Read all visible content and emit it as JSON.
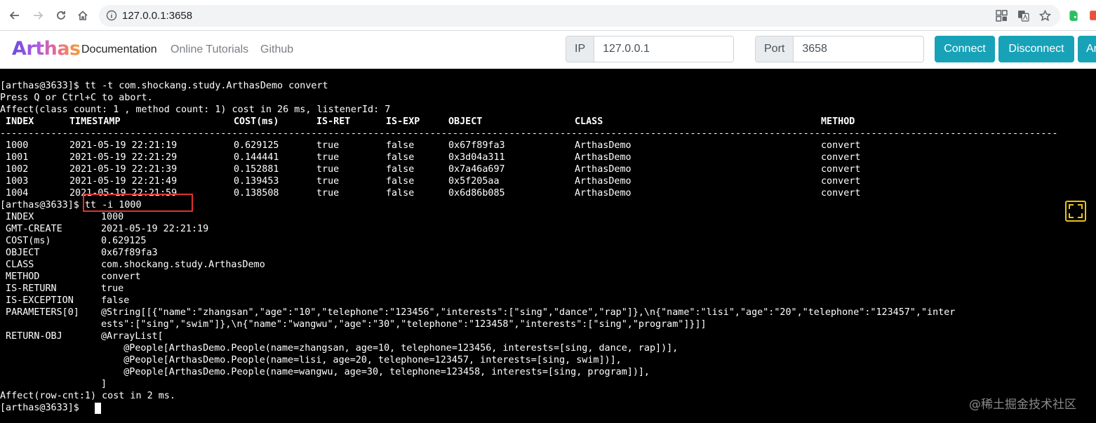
{
  "browser": {
    "url": "127.0.0.1:3658"
  },
  "app": {
    "logo": "Arthas",
    "nav": {
      "documentation": "Documentation",
      "tutorials": "Online Tutorials",
      "github": "Github"
    },
    "ip": {
      "label": "IP",
      "value": "127.0.0.1"
    },
    "port": {
      "label": "Port",
      "value": "3658"
    },
    "buttons": {
      "connect": "Connect",
      "disconnect": "Disconnect",
      "more": "Ar"
    },
    "colors": {
      "button": "#17a2b8"
    }
  },
  "terminal": {
    "cmd1": "[arthas@3633]$ tt -t com.shockang.study.ArthasDemo convert",
    "abort": "Press Q or Ctrl+C to abort.",
    "affect1": "Affect(class count: 1 , method count: 1) cost in 26 ms, listenerId: 7",
    "headers": {
      "index": " INDEX",
      "timestamp": "TIMESTAMP",
      "cost": "COST(ms)",
      "isret": "IS-RET",
      "isexp": "IS-EXP",
      "object": "OBJECT",
      "class": "CLASS",
      "method": "METHOD"
    },
    "rows": [
      {
        "index": " 1000",
        "timestamp": "2021-05-19 22:21:19",
        "cost": "0.629125",
        "isret": "true",
        "isexp": "false",
        "object": "0x67f89fa3",
        "class": "ArthasDemo",
        "method": "convert"
      },
      {
        "index": " 1001",
        "timestamp": "2021-05-19 22:21:29",
        "cost": "0.144441",
        "isret": "true",
        "isexp": "false",
        "object": "0x3d04a311",
        "class": "ArthasDemo",
        "method": "convert"
      },
      {
        "index": " 1002",
        "timestamp": "2021-05-19 22:21:39",
        "cost": "0.152881",
        "isret": "true",
        "isexp": "false",
        "object": "0x7a46a697",
        "class": "ArthasDemo",
        "method": "convert"
      },
      {
        "index": " 1003",
        "timestamp": "2021-05-19 22:21:49",
        "cost": "0.139453",
        "isret": "true",
        "isexp": "false",
        "object": "0x5f205aa",
        "class": "ArthasDemo",
        "method": "convert"
      },
      {
        "index": " 1004",
        "timestamp": "2021-05-19 22:21:59",
        "cost": "0.138508",
        "isret": "true",
        "isexp": "false",
        "object": "0x6d86b085",
        "class": "ArthasDemo",
        "method": "convert"
      }
    ],
    "cmd2": "[arthas@3633]$ tt -i 1000",
    "details": [
      {
        "key": " INDEX",
        "value": "1000"
      },
      {
        "key": " GMT-CREATE",
        "value": "2021-05-19 22:21:19"
      },
      {
        "key": " COST(ms)",
        "value": "0.629125"
      },
      {
        "key": " OBJECT",
        "value": "0x67f89fa3"
      },
      {
        "key": " CLASS",
        "value": "com.shockang.study.ArthasDemo"
      },
      {
        "key": " METHOD",
        "value": "convert"
      },
      {
        "key": " IS-RETURN",
        "value": "true"
      },
      {
        "key": " IS-EXCEPTION",
        "value": "false"
      },
      {
        "key": " PARAMETERS[0]",
        "value": "@String[[{\"name\":\"zhangsan\",\"age\":\"10\",\"telephone\":\"123456\",\"interests\":[\"sing\",\"dance\",\"rap\"]},\\n{\"name\":\"lisi\",\"age\":\"20\",\"telephone\":\"123457\",\"inter"
      },
      {
        "key": "",
        "value": "ests\":[\"sing\",\"swim\"]},\\n{\"name\":\"wangwu\",\"age\":\"30\",\"telephone\":\"123458\",\"interests\":[\"sing\",\"program\"]}]]"
      },
      {
        "key": " RETURN-OBJ",
        "value": "@ArrayList["
      },
      {
        "key": "",
        "value": "    @People[ArthasDemo.People(name=zhangsan, age=10, telephone=123456, interests=[sing, dance, rap])],"
      },
      {
        "key": "",
        "value": "    @People[ArthasDemo.People(name=lisi, age=20, telephone=123457, interests=[sing, swim])],"
      },
      {
        "key": "",
        "value": "    @People[ArthasDemo.People(name=wangwu, age=30, telephone=123458, interests=[sing, program])],"
      },
      {
        "key": "",
        "value": "]"
      }
    ],
    "affect2": "Affect(row-cnt:1) cost in 2 ms.",
    "prompt": "[arthas@3633]$ "
  },
  "watermark": "@稀土掘金技术社区"
}
